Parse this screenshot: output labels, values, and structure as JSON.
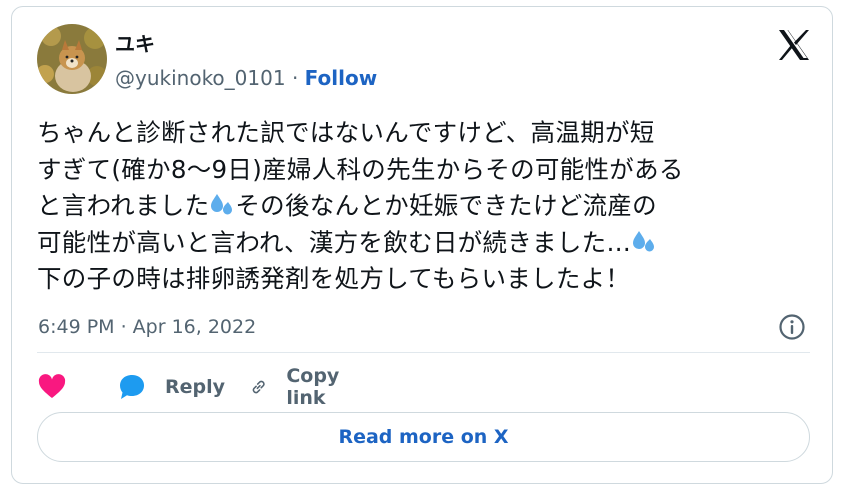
{
  "author": {
    "name": "ユキ",
    "handle": "@yukinoko_0101",
    "separator": "·",
    "follow_label": "Follow"
  },
  "brand": {
    "logo_icon": "x-logo-icon"
  },
  "tweet": {
    "lines": [
      [
        "ちゃんと診断された訳ではないんですけど、高温期が短"
      ],
      [
        "すぎて(確か8〜9日)産婦人科の先生からその可能性がある"
      ],
      [
        "と言われました",
        "その後なんとか妊娠できたけど流産の"
      ],
      [
        "可能性が高いと言われ、漢方を飲む日が続きました…"
      ],
      [
        "下の子の時は排卵誘発剤を処方してもらいましたよ！"
      ]
    ],
    "emoji_icon": "sweat-droplets-icon"
  },
  "meta": {
    "timestamp": "6:49 PM · Apr 16, 2022",
    "info_icon": "info-icon"
  },
  "actions": {
    "like_icon": "heart-icon",
    "reply_icon": "speech-bubble-icon",
    "reply_label": "Reply",
    "copy_icon": "link-icon",
    "copy_label": "Copy link"
  },
  "cta": {
    "read_more_label": "Read more on X"
  },
  "colors": {
    "accent": "#1d64c3",
    "text": "#0f1419",
    "muted": "#536471",
    "heart": "#f91880",
    "emoji": "#5dadec",
    "border": "#cfd9de"
  }
}
